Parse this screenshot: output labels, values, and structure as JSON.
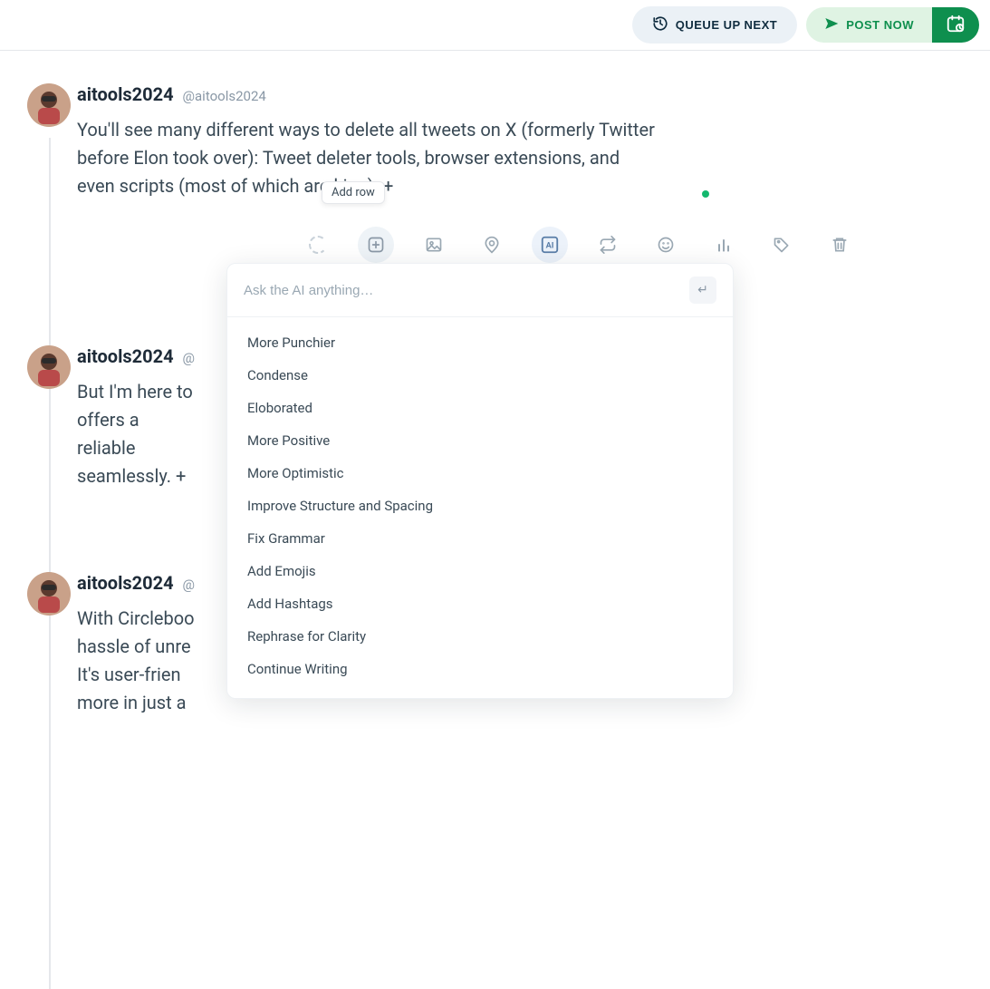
{
  "topbar": {
    "queue_label": "QUEUE UP NEXT",
    "post_label": "POST NOW"
  },
  "user": {
    "name": "aitools2024",
    "handle": "@aitools2024"
  },
  "posts": [
    {
      "text": "You'll see many different ways to delete all tweets on X (formerly Twitter before Elon took over): Tweet deleter tools, browser extensions, and even scripts (most of which are        king). +"
    },
    {
      "text": "But I'm here to offers a reliable seamlessly. +"
    },
    {
      "text": "With Circleboo hassle of unre It's user-frien more in just a"
    }
  ],
  "tooltip": "Add row",
  "ai": {
    "placeholder": "Ask the AI anything…",
    "options": [
      "More Punchier",
      "Condense",
      "Eloborated",
      "More Positive",
      "More Optimistic",
      "Improve Structure and Spacing",
      "Fix Grammar",
      "Add Emojis",
      "Add Hashtags",
      "Rephrase for Clarity",
      "Continue Writing"
    ]
  }
}
